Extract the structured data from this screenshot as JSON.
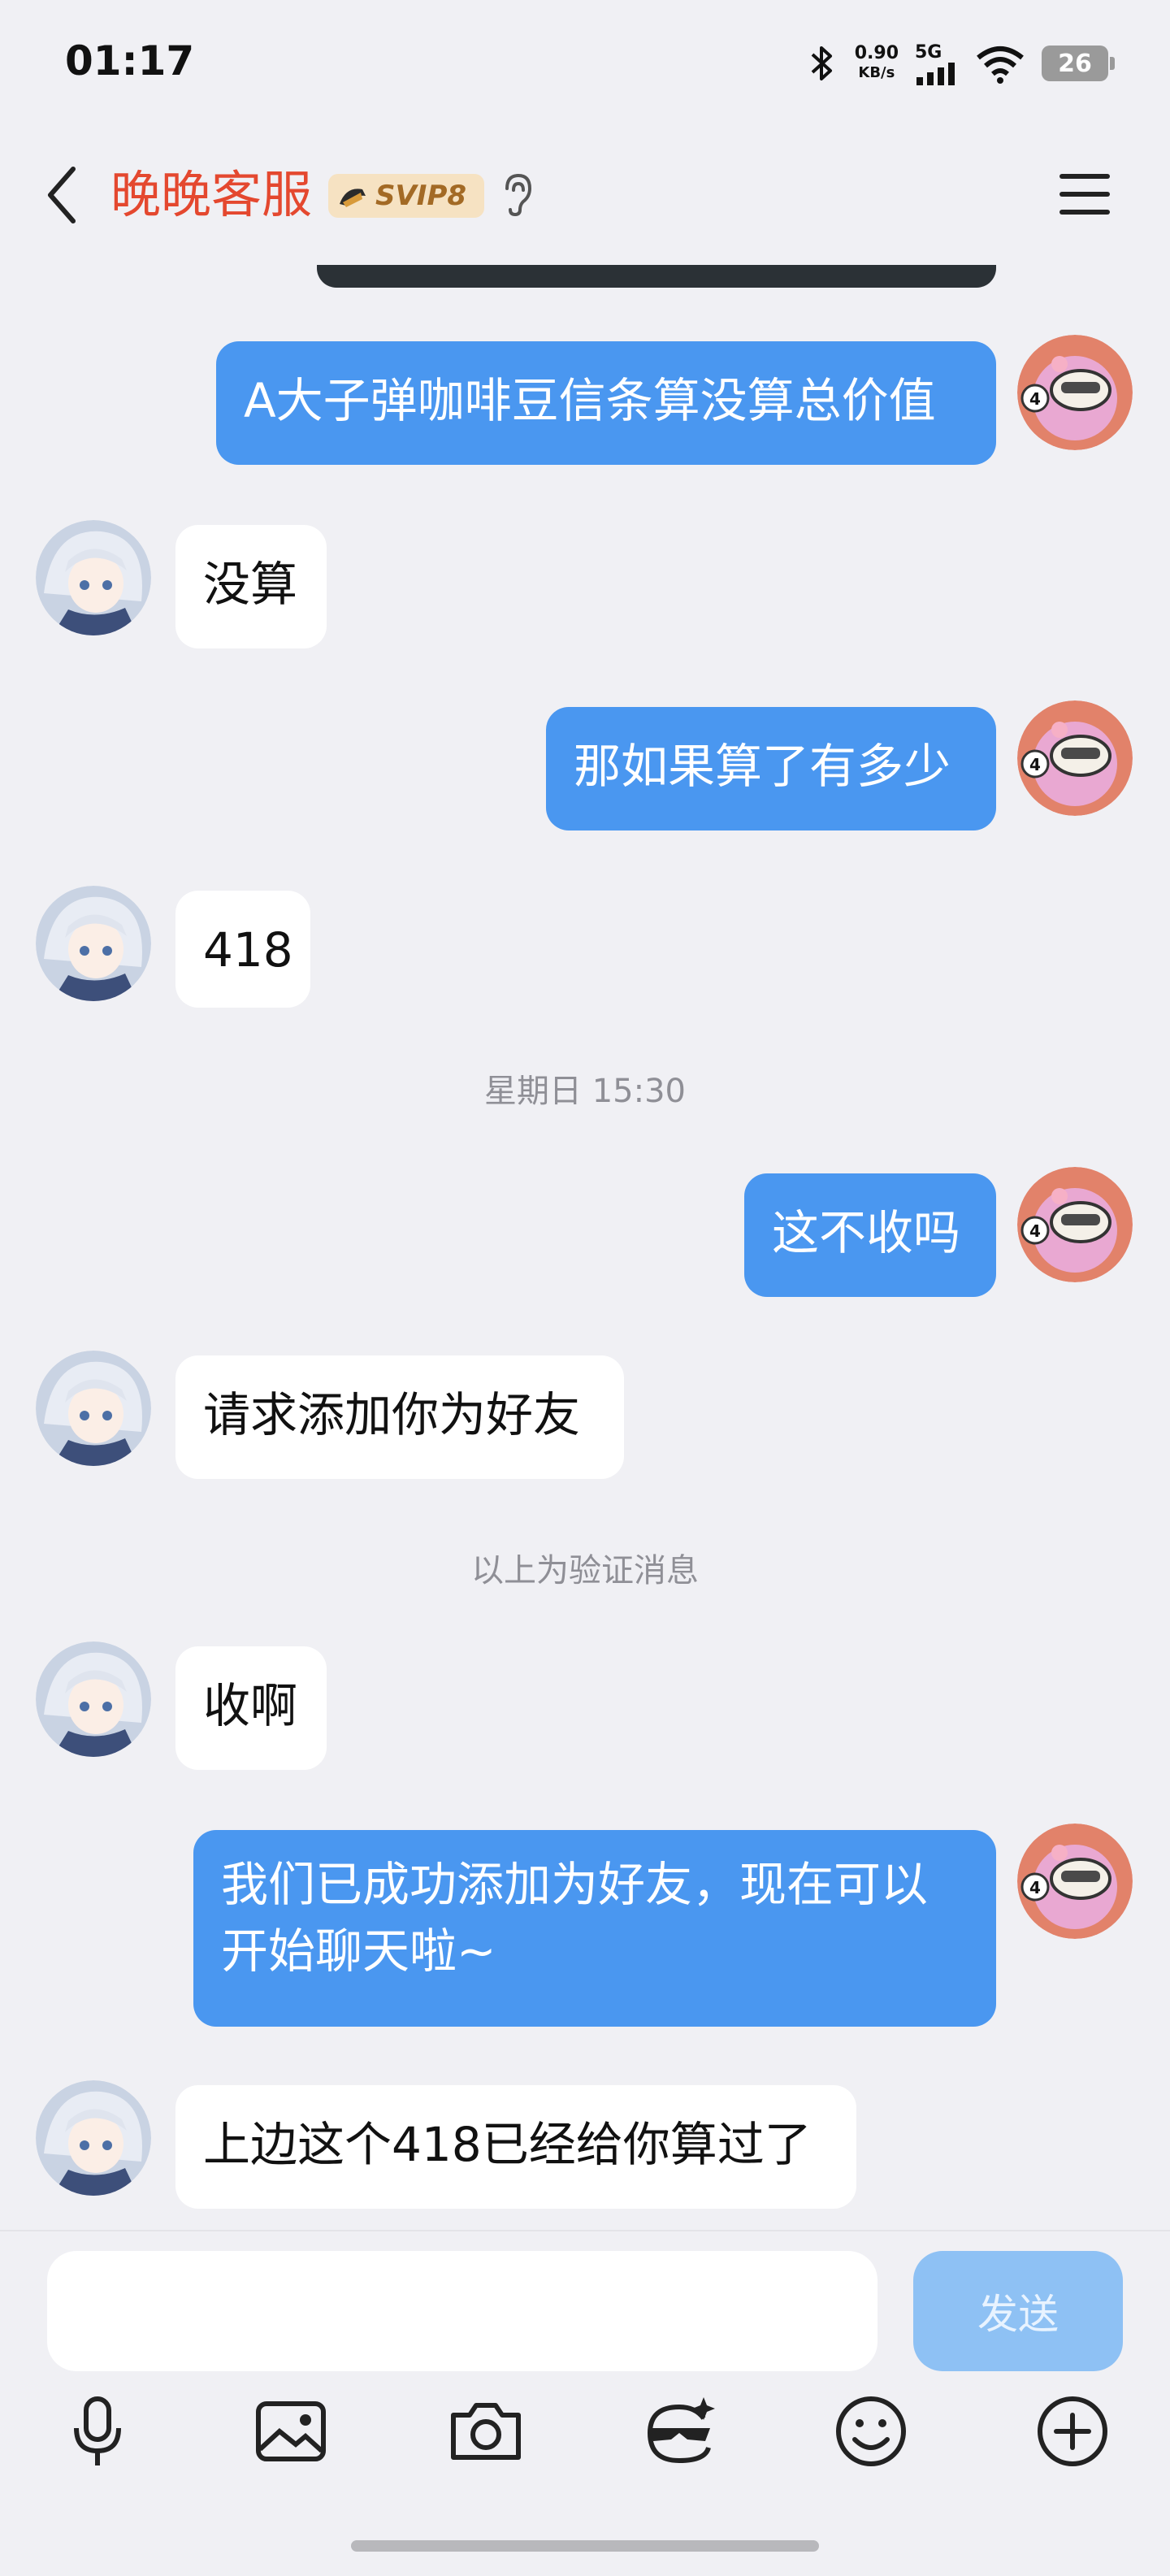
{
  "status_bar": {
    "time": "01:17",
    "net_speed": "0.90",
    "net_unit": "KB/s",
    "network": "5G",
    "battery": "26"
  },
  "header": {
    "title": "晚晚客服",
    "vip_badge": "SVIP8"
  },
  "messages": [
    {
      "side": "out",
      "text": "A大子弹咖啡豆信条算没算总价值"
    },
    {
      "side": "in",
      "text": "没算"
    },
    {
      "side": "out",
      "text": "那如果算了有多少"
    },
    {
      "side": "in",
      "text": "418"
    },
    {
      "side": "sep",
      "text": "星期日 15:30"
    },
    {
      "side": "out",
      "text": "这不收吗"
    },
    {
      "side": "in",
      "text": "请求添加你为好友"
    },
    {
      "side": "sep",
      "text": "以上为验证消息"
    },
    {
      "side": "in",
      "text": "收啊"
    },
    {
      "side": "out",
      "text": "我们已成功添加为好友，现在可以开始聊天啦~"
    },
    {
      "side": "in",
      "text": "上边这个418已经给你算过了"
    }
  ],
  "composer": {
    "placeholder": "",
    "send_label": "发送"
  },
  "toolbar": [
    "microphone-icon",
    "image-icon",
    "camera-icon",
    "sticker-icon",
    "emoji-icon",
    "plus-icon"
  ],
  "colors": {
    "outgoing_bubble": "#4a97f0",
    "incoming_bubble": "#ffffff",
    "title": "#e4482f",
    "send_button": "#8ec1f4"
  }
}
